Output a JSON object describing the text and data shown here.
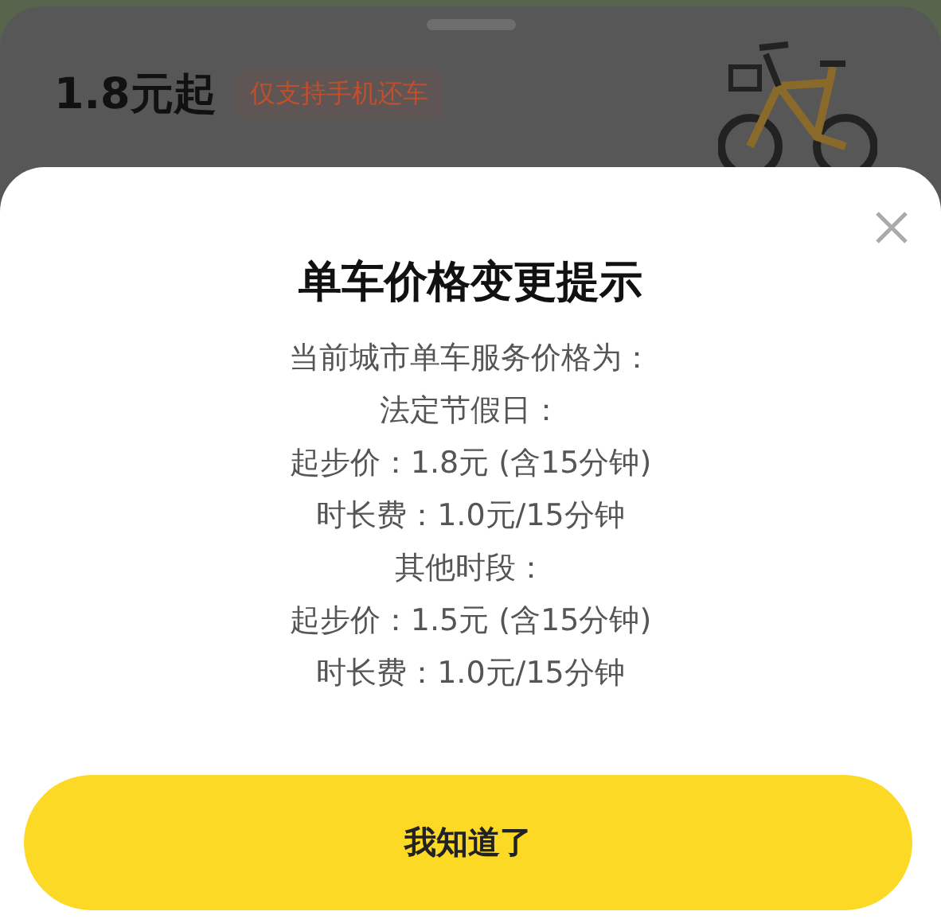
{
  "background_card": {
    "price": "1.8元起",
    "tag": "仅支持手机还车"
  },
  "dialog": {
    "title": "单车价格变更提示",
    "lines": [
      "当前城市单车服务价格为：",
      "法定节假日：",
      "起步价：1.8元 (含15分钟)",
      "时长费：1.0元/15分钟",
      "其他时段：",
      "起步价：1.5元 (含15分钟)",
      "时长费：1.0元/15分钟"
    ],
    "button": "我知道了"
  }
}
